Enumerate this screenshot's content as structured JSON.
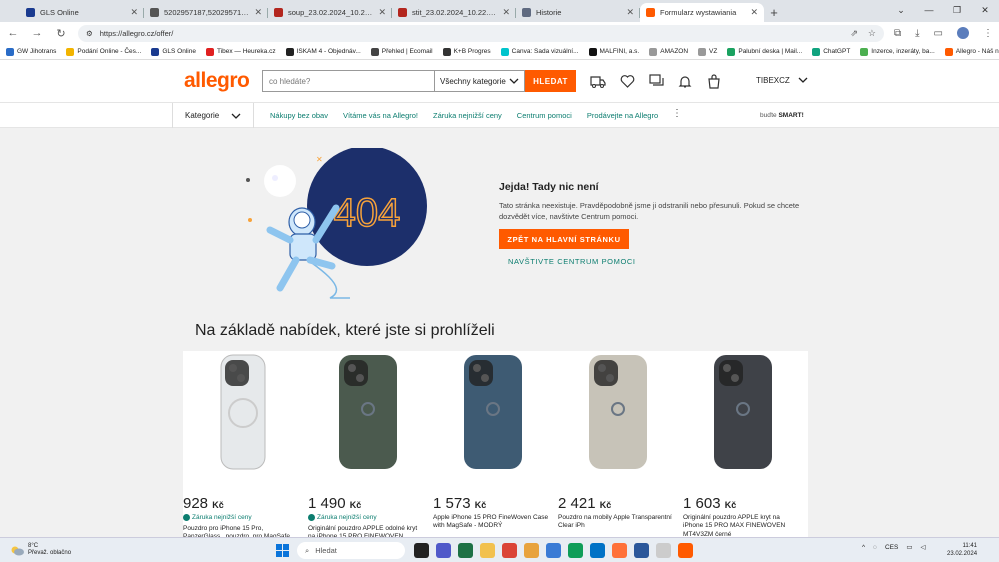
{
  "browser": {
    "tabs": [
      {
        "title": "GLS Online",
        "color": "#1a3a8f",
        "active": false
      },
      {
        "title": "5202957187,5202957188,5202",
        "color": "#555555",
        "active": false
      },
      {
        "title": "soup_23.02.2024_10.22.40.pdf",
        "color": "#b3261e",
        "active": false
      },
      {
        "title": "stit_23.02.2024_10.22.17.pdf",
        "color": "#b3261e",
        "active": false
      },
      {
        "title": "Historie",
        "color": "#5f6a80",
        "active": false
      },
      {
        "title": "Formularz wystawiania",
        "color": "#ff5a00",
        "active": true
      }
    ],
    "url": "https://allegro.cz/offer/",
    "bookmarks": [
      {
        "label": "GW Jihotrans",
        "color": "#2a6cc7"
      },
      {
        "label": "Podání Online - Čes...",
        "color": "#f2b400"
      },
      {
        "label": "GLS Online",
        "color": "#1a3a8f"
      },
      {
        "label": "Tibex — Heureka.cz",
        "color": "#e02020"
      },
      {
        "label": "ISKAM 4 - Objednáv...",
        "color": "#222222"
      },
      {
        "label": "Přehled | Ecomail",
        "color": "#444444"
      },
      {
        "label": "K+B Progres",
        "color": "#333333"
      },
      {
        "label": "Canva: Sada vizuální...",
        "color": "#00c4cc"
      },
      {
        "label": "MALFINI, a.s.",
        "color": "#111111"
      },
      {
        "label": "AMAZON",
        "color": "#999999"
      },
      {
        "label": "VZ",
        "color": "#999999"
      },
      {
        "label": "Palubní deska | Mail...",
        "color": "#1aa260"
      },
      {
        "label": "ChatGPT",
        "color": "#10a37f"
      },
      {
        "label": "Inzerce, inzeráty, ba...",
        "color": "#4caf50"
      },
      {
        "label": "Allegro - Náš největ...",
        "color": "#ff5a00"
      }
    ]
  },
  "header": {
    "logo": "allegro",
    "search_placeholder": "co hledáte?",
    "category_select": "Všechny kategorie",
    "search_button": "HLEDAT",
    "user": "TIBEXCZ"
  },
  "catbar": {
    "categories_label": "Kategorie",
    "links": [
      "Nákupy bez obav",
      "Vítáme vás na Allegro!",
      "Záruka nejnižší ceny",
      "Centrum pomoci",
      "Prodávejte na Allegro"
    ],
    "smart_prefix": "buďte",
    "smart_brand": "SMART!"
  },
  "error": {
    "code": "404",
    "title": "Jejda! Tady nic není",
    "text": "Tato stránka neexistuje. Pravděpodobně jsme ji odstranili nebo přesunuli. Pokud se chcete dozvědět více, navštivte Centrum pomoci.",
    "primary_button": "ZPĚT NA HLAVNÍ STRÁNKU",
    "secondary_link": "NAVŠTIVTE CENTRUM POMOCI"
  },
  "recommendations": {
    "heading": "Na základě nabídek, které jste si prohlíželi",
    "products": [
      {
        "price": "928",
        "currency": "Kč",
        "guarantee": "Záruka nejnižší ceny",
        "title": "Pouzdro pro iPhone 15 Pro, PanzerGlass , pouzdro, pro MagSafe",
        "case_color": "#e6e9eb"
      },
      {
        "price": "1 490",
        "currency": "Kč",
        "guarantee": "Záruka nejnižší ceny",
        "title": "Originální pouzdro APPLE odolné kryt na iPhone 15 PRO FINEWOVEN",
        "case_color": "#4b5a4e"
      },
      {
        "price": "1 573",
        "currency": "Kč",
        "guarantee": "",
        "title": "Apple iPhone 15 PRO FineWoven Case with MagSafe - MODRÝ",
        "case_color": "#3e5b73"
      },
      {
        "price": "2 421",
        "currency": "Kč",
        "guarantee": "",
        "title": "Pouzdro na mobily Apple Transparentní Clear iPh",
        "case_color": "#c7c3b8"
      },
      {
        "price": "1 603",
        "currency": "Kč",
        "guarantee": "",
        "title": "Originální pouzdro APPLE kryt na iPhone 15 PRO MAX FINEWOVEN MT4V3ZM černé",
        "case_color": "#3f4248"
      }
    ]
  },
  "taskbar": {
    "weather_temp": "8°C",
    "weather_desc": "Převaž. oblačno",
    "search_placeholder": "Hledat",
    "lang": "CES",
    "time": "11:41",
    "date": "23.02.2024"
  }
}
